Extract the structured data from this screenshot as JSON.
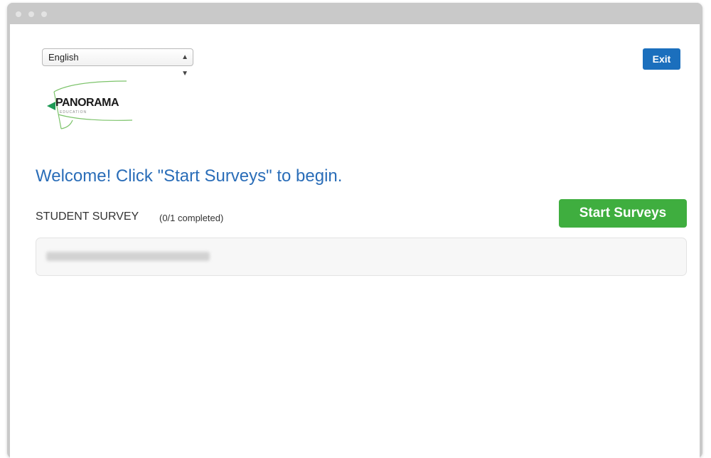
{
  "window": {
    "title_dots": [
      "red-dot",
      "yellow-dot",
      "green-dot"
    ]
  },
  "header": {
    "language_select": {
      "selected": "English",
      "arrow_icon": "updown-arrows-icon"
    },
    "exit_label": "Exit"
  },
  "logo": {
    "wordmark": "PANORAMA",
    "subtext": "EDUCATION"
  },
  "main": {
    "welcome_text": "Welcome! Click \"Start Surveys\" to begin.",
    "survey_title": "STUDENT SURVEY",
    "survey_progress": "(0/1 completed)",
    "start_button_label": "Start Surveys"
  },
  "colors": {
    "accent_blue": "#1b6fbd",
    "welcome_blue": "#2a6db8",
    "start_green": "#3fae3f"
  }
}
